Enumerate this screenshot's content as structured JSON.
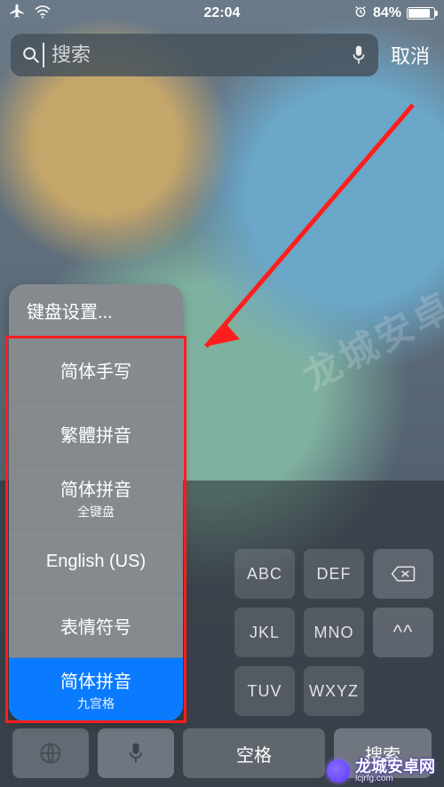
{
  "status": {
    "time": "22:04",
    "battery_pct": "84%"
  },
  "search": {
    "placeholder": "搜索",
    "cancel": "取消"
  },
  "popup": {
    "settings": "键盘设置...",
    "items": [
      {
        "label": "简体手写",
        "sublabel": ""
      },
      {
        "label": "繁體拼音",
        "sublabel": ""
      },
      {
        "label": "简体拼音",
        "sublabel": "全键盘"
      },
      {
        "label": "English (US)",
        "sublabel": ""
      },
      {
        "label": "表情符号",
        "sublabel": ""
      },
      {
        "label": "简体拼音",
        "sublabel": "九宫格",
        "active": true
      }
    ]
  },
  "keys": {
    "row1": [
      "ABC",
      "DEF",
      "⌫"
    ],
    "row2": [
      "JKL",
      "MNO",
      "^^"
    ],
    "row3": [
      "TUV",
      "WXYZ",
      ""
    ]
  },
  "bottom": {
    "space": "空格",
    "search": "搜索"
  },
  "watermark": {
    "big": "龙城安卓网",
    "foot": "龙城安卓网",
    "foot2": "lcjrfg.com"
  }
}
